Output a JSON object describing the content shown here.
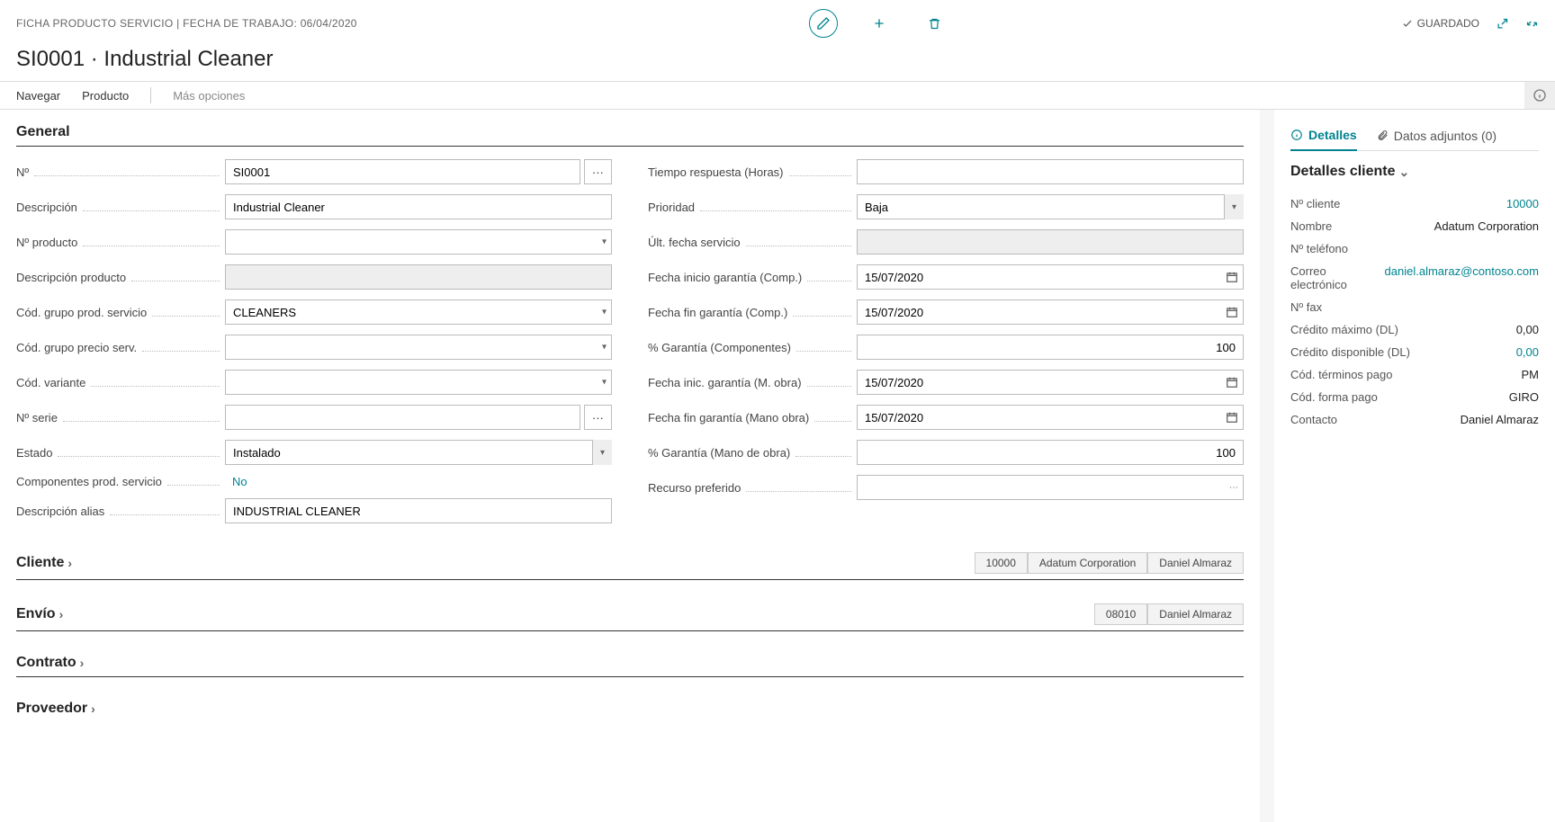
{
  "header": {
    "breadcrumb": "FICHA PRODUCTO SERVICIO | FECHA DE TRABAJO: 06/04/2020",
    "saved_label": "GUARDADO"
  },
  "page_title": "SI0001 · Industrial Cleaner",
  "nav": {
    "navigate": "Navegar",
    "product": "Producto",
    "more": "Más opciones"
  },
  "sections": {
    "general": "General",
    "cliente": "Cliente",
    "envio": "Envío",
    "contrato": "Contrato",
    "proveedor": "Proveedor"
  },
  "general": {
    "left": {
      "no_label": "Nº",
      "no_value": "SI0001",
      "desc_label": "Descripción",
      "desc_value": "Industrial Cleaner",
      "prod_no_label": "Nº producto",
      "prod_no_value": "",
      "prod_desc_label": "Descripción producto",
      "prod_desc_value": "",
      "group_code_label": "Cód. grupo prod. servicio",
      "group_code_value": "CLEANERS",
      "price_group_label": "Cód. grupo precio serv.",
      "price_group_value": "",
      "variant_label": "Cód. variante",
      "variant_value": "",
      "serial_label": "Nº serie",
      "serial_value": "",
      "status_label": "Estado",
      "status_value": "Instalado",
      "components_label": "Componentes prod. servicio",
      "components_value": "No",
      "alias_label": "Descripción alias",
      "alias_value": "INDUSTRIAL CLEANER"
    },
    "right": {
      "resp_time_label": "Tiempo respuesta (Horas)",
      "resp_time_value": "",
      "priority_label": "Prioridad",
      "priority_value": "Baja",
      "last_service_label": "Últ. fecha servicio",
      "last_service_value": "",
      "warr_start_comp_label": "Fecha inicio garantía (Comp.)",
      "warr_start_comp_value": "15/07/2020",
      "warr_end_comp_label": "Fecha fin garantía (Comp.)",
      "warr_end_comp_value": "15/07/2020",
      "warr_pct_comp_label": "% Garantía (Componentes)",
      "warr_pct_comp_value": "100",
      "warr_start_labor_label": "Fecha inic. garantía (M. obra)",
      "warr_start_labor_value": "15/07/2020",
      "warr_end_labor_label": "Fecha fin garantía (Mano obra)",
      "warr_end_labor_value": "15/07/2020",
      "warr_pct_labor_label": "% Garantía (Mano de obra)",
      "warr_pct_labor_value": "100",
      "pref_resource_label": "Recurso preferido",
      "pref_resource_value": ""
    }
  },
  "cliente_summary": {
    "t1": "10000",
    "t2": "Adatum Corporation",
    "t3": "Daniel Almaraz"
  },
  "envio_summary": {
    "t1": "08010",
    "t2": "Daniel Almaraz"
  },
  "side": {
    "tab_details": "Detalles",
    "tab_attachments": "Datos adjuntos (0)",
    "section_title": "Detalles cliente",
    "cust_no_label": "Nº cliente",
    "cust_no_value": "10000",
    "name_label": "Nombre",
    "name_value": "Adatum Corporation",
    "phone_label": "Nº teléfono",
    "phone_value": "",
    "email_label": "Correo electrónico",
    "email_value": "daniel.almaraz@contoso.com",
    "fax_label": "Nº fax",
    "fax_value": "",
    "credit_max_label": "Crédito máximo (DL)",
    "credit_max_value": "0,00",
    "credit_avail_label": "Crédito disponible (DL)",
    "credit_avail_value": "0,00",
    "terms_label": "Cód. términos pago",
    "terms_value": "PM",
    "method_label": "Cód. forma pago",
    "method_value": "GIRO",
    "contact_label": "Contacto",
    "contact_value": "Daniel Almaraz"
  }
}
